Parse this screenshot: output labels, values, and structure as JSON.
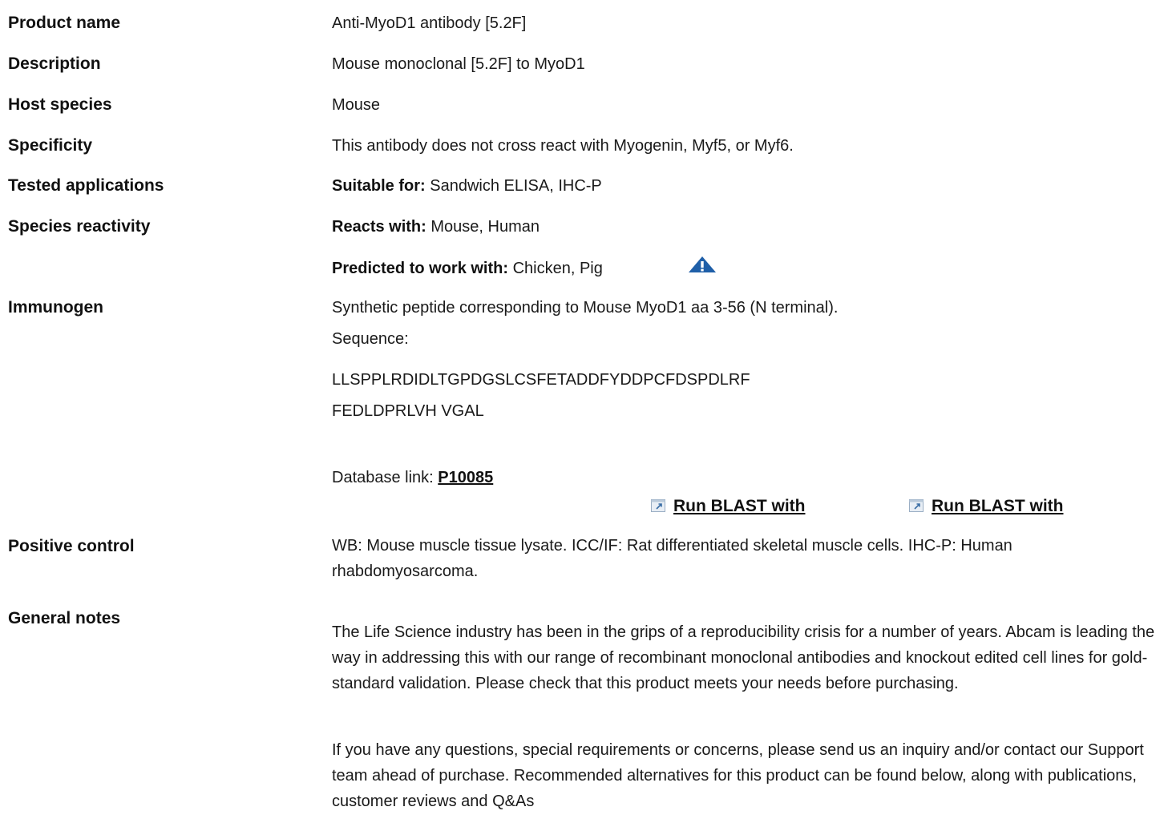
{
  "rows": {
    "product_name": {
      "label": "Product name",
      "value": "Anti-MyoD1 antibody [5.2F]"
    },
    "description": {
      "label": "Description",
      "value": "Mouse monoclonal [5.2F] to MyoD1"
    },
    "host_species": {
      "label": "Host species",
      "value": "Mouse"
    },
    "specificity": {
      "label": "Specificity",
      "value": "This antibody does not cross react with Myogenin, Myf5, or Myf6."
    },
    "tested_applications": {
      "label": "Tested applications",
      "prefix": "Suitable for:",
      "value": " Sandwich ELISA, IHC-P"
    },
    "species_reactivity": {
      "label": "Species reactivity",
      "reacts_prefix": "Reacts with:",
      "reacts_value": " Mouse, Human",
      "predicted_prefix": "Predicted to work with:",
      "predicted_value": " Chicken, Pig",
      "warning_icon": "triangle-warning-icon"
    },
    "immunogen": {
      "label": "Immunogen",
      "line1": "Synthetic peptide corresponding to Mouse MyoD1 aa 3-56 (N terminal).",
      "line2": "Sequence:",
      "seq1": "LLSPPLRDIDLTGPDGSLCSFETADDFYDDPCFDSPDLRF",
      "seq2": "FEDLDPRLVH VGAL",
      "db_prefix": "Database link: ",
      "db_link": "P10085",
      "blast_1": "Run BLAST with",
      "blast_2": "Run BLAST with"
    },
    "positive_control": {
      "label": "Positive control",
      "value": "WB: Mouse muscle tissue lysate. ICC/IF: Rat differentiated skeletal muscle cells. IHC-P: Human rhabdomyosarcoma."
    },
    "general_notes": {
      "label": "General notes",
      "para1": "The Life Science industry has been in the grips of a reproducibility crisis for a number of years. Abcam is leading the way in addressing this with our range of recombinant monoclonal antibodies and knockout edited cell lines for gold-standard validation. Please check that this product meets your needs before purchasing.",
      "para2": "If you have any questions, special requirements or concerns, please send us an inquiry and/or contact our Support team ahead of purchase. Recommended alternatives for this product can be found below, along with publications, customer reviews and Q&As"
    }
  },
  "colors": {
    "text": "#1a1a1a",
    "label": "#111111",
    "icon_blue": "#1f5fa8"
  }
}
